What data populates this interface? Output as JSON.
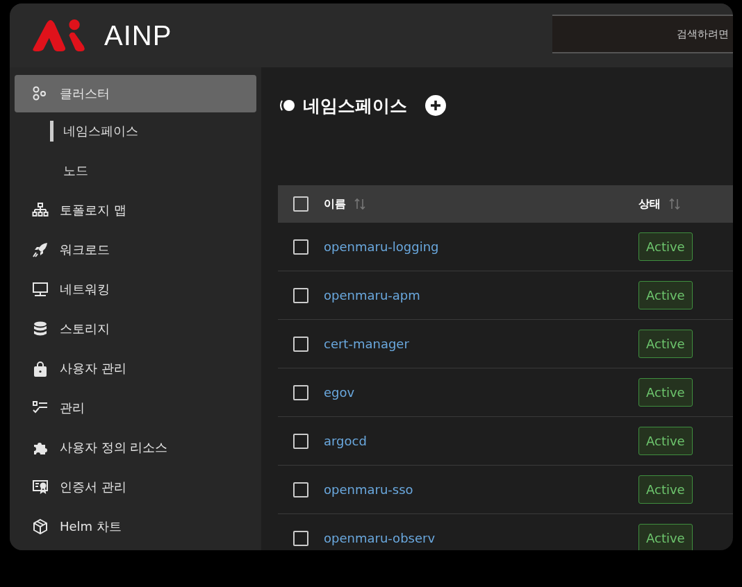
{
  "logo": {
    "text": "AINP"
  },
  "search": {
    "placeholder": "검색하려면"
  },
  "sidebar": {
    "items": [
      {
        "label": "클러스터",
        "selected": true,
        "children": [
          {
            "label": "네임스페이스",
            "selected": true
          },
          {
            "label": "노드",
            "selected": false
          }
        ]
      },
      {
        "label": "토폴로지 맵",
        "selected": false
      },
      {
        "label": "워크로드",
        "selected": false
      },
      {
        "label": "네트워킹",
        "selected": false
      },
      {
        "label": "스토리지",
        "selected": false
      },
      {
        "label": "사용자 관리",
        "selected": false
      },
      {
        "label": "관리",
        "selected": false
      },
      {
        "label": "사용자 정의 리소스",
        "selected": false
      },
      {
        "label": "인증서 관리",
        "selected": false
      },
      {
        "label": "Helm 차트",
        "selected": false
      }
    ]
  },
  "page": {
    "title": "네임스페이스"
  },
  "table": {
    "columns": [
      "이름",
      "상태"
    ],
    "all_checked": false,
    "rows": [
      {
        "name": "openmaru-logging",
        "status": "Active",
        "checked": false
      },
      {
        "name": "openmaru-apm",
        "status": "Active",
        "checked": false
      },
      {
        "name": "cert-manager",
        "status": "Active",
        "checked": false
      },
      {
        "name": "egov",
        "status": "Active",
        "checked": false
      },
      {
        "name": "argocd",
        "status": "Active",
        "checked": false
      },
      {
        "name": "openmaru-sso",
        "status": "Active",
        "checked": false
      },
      {
        "name": "openmaru-observ",
        "status": "Active",
        "checked": false
      }
    ]
  }
}
